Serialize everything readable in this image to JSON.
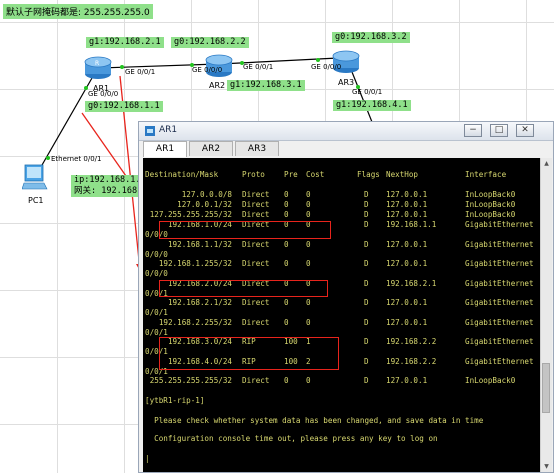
{
  "topology": {
    "note": "默认子网掩码都是: 255.255.255.0",
    "labels": {
      "ar1_top": "g1:192.168.2.1",
      "ar1_bottom": "g0:192.168.1.1",
      "ar2_top": "g0:192.168.2.2",
      "ar2_bottom": "g1:192.168.3.1",
      "ar3_top": "g0:192.168.3.2",
      "ar3_bottom": "g1:192.168.4.1",
      "pc1_ip": "ip:192.168.1.2",
      "pc1_gw": "网关: 192.168.1.1"
    },
    "ports": {
      "ar1_right": "GE 0/0/1",
      "ar1_down": "GE 0/0/0",
      "ar2_left": "GE 0/0/0",
      "ar2_right": "GE 0/0/1",
      "ar3_left": "GE 0/0/0",
      "ar3_down": "GE 0/0/1",
      "pc1": "Ethernet 0/0/1"
    },
    "devices": {
      "ar1": "AR1",
      "ar2": "AR2",
      "ar3": "AR3",
      "pc1": "PC1"
    }
  },
  "window": {
    "title": "AR1",
    "min": "−",
    "max": "□",
    "close": "✕",
    "tabs": [
      "AR1",
      "AR2",
      "AR3"
    ],
    "active_tab": "AR1"
  },
  "console": {
    "header": {
      "dest": "Destination/Mask",
      "proto": "Proto",
      "pre": "Pre",
      "cost": "Cost",
      "flags": "Flags",
      "nexthop": "NextHop",
      "iface": "Interface"
    },
    "routes": [
      {
        "dest": "127.0.0.0/8",
        "proto": "Direct",
        "pre": "0",
        "cost": "0",
        "flags": "D",
        "nexthop": "127.0.0.1",
        "iface": "InLoopBack0",
        "wrap": ""
      },
      {
        "dest": "127.0.0.1/32",
        "proto": "Direct",
        "pre": "0",
        "cost": "0",
        "flags": "D",
        "nexthop": "127.0.0.1",
        "iface": "InLoopBack0",
        "wrap": ""
      },
      {
        "dest": "127.255.255.255/32",
        "proto": "Direct",
        "pre": "0",
        "cost": "0",
        "flags": "D",
        "nexthop": "127.0.0.1",
        "iface": "InLoopBack0",
        "wrap": ""
      },
      {
        "dest": "192.168.1.0/24",
        "proto": "Direct",
        "pre": "0",
        "cost": "0",
        "flags": "D",
        "nexthop": "192.168.1.1",
        "iface": "GigabitEthernet",
        "wrap": "0/0/0"
      },
      {
        "dest": "192.168.1.1/32",
        "proto": "Direct",
        "pre": "0",
        "cost": "0",
        "flags": "D",
        "nexthop": "127.0.0.1",
        "iface": "GigabitEthernet",
        "wrap": "0/0/0"
      },
      {
        "dest": "192.168.1.255/32",
        "proto": "Direct",
        "pre": "0",
        "cost": "0",
        "flags": "D",
        "nexthop": "127.0.0.1",
        "iface": "GigabitEthernet",
        "wrap": "0/0/0"
      },
      {
        "dest": "192.168.2.0/24",
        "proto": "Direct",
        "pre": "0",
        "cost": "0",
        "flags": "D",
        "nexthop": "192.168.2.1",
        "iface": "GigabitEthernet",
        "wrap": "0/0/1"
      },
      {
        "dest": "192.168.2.1/32",
        "proto": "Direct",
        "pre": "0",
        "cost": "0",
        "flags": "D",
        "nexthop": "127.0.0.1",
        "iface": "GigabitEthernet",
        "wrap": "0/0/1"
      },
      {
        "dest": "192.168.2.255/32",
        "proto": "Direct",
        "pre": "0",
        "cost": "0",
        "flags": "D",
        "nexthop": "127.0.0.1",
        "iface": "GigabitEthernet",
        "wrap": "0/0/1"
      },
      {
        "dest": "192.168.3.0/24",
        "proto": "RIP",
        "pre": "100",
        "cost": "1",
        "flags": "D",
        "nexthop": "192.168.2.2",
        "iface": "GigabitEthernet",
        "wrap": "0/0/1"
      },
      {
        "dest": "192.168.4.0/24",
        "proto": "RIP",
        "pre": "100",
        "cost": "2",
        "flags": "D",
        "nexthop": "192.168.2.2",
        "iface": "GigabitEthernet",
        "wrap": "0/0/1"
      },
      {
        "dest": "255.255.255.255/32",
        "proto": "Direct",
        "pre": "0",
        "cost": "0",
        "flags": "D",
        "nexthop": "127.0.0.1",
        "iface": "InLoopBack0",
        "wrap": ""
      }
    ],
    "prompt": "[ytbR1-rip-1]",
    "msg1": "  Please check whether system data has been changed, and save data in time",
    "msg2": "  Configuration console time out, please press any key to log on"
  }
}
